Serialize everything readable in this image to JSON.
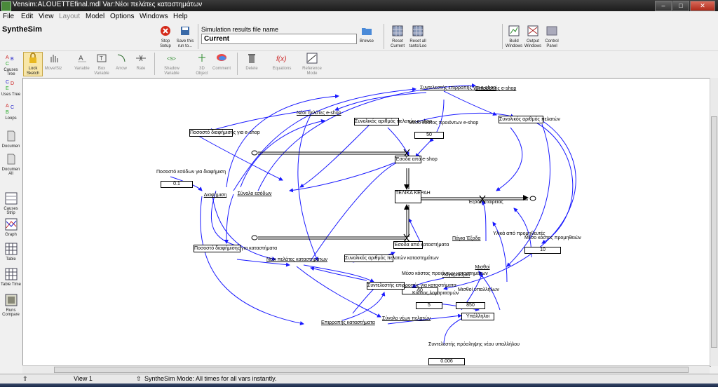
{
  "window": {
    "title": "Vensim:ALOUETTEfinal.mdl Var:Νέοι πελάτες καταστημάτων"
  },
  "menu": {
    "file": "File",
    "edit": "Edit",
    "view": "View",
    "layout": "Layout",
    "model": "Model",
    "options": "Options",
    "windows": "Windows",
    "help": "Help"
  },
  "toolbar": {
    "synthesim": "SyntheSim",
    "stop_setup": "Stop Setup",
    "save_run": "Save this run to...",
    "sim_file_label": "Simulation results file name",
    "sim_file_value": "Current",
    "browse": "Browse",
    "reset_current": "Reset Current",
    "reset_all": "Reset all tants/Loo",
    "build_windows": "Build Windows",
    "output_windows": "Output Windows",
    "control_panel": "Control Panel"
  },
  "sketch_tools": {
    "lock": "Lock Sketch",
    "move": "Move/Siz",
    "variable": "Variable",
    "box": "Box Variable",
    "arrow": "Arrow",
    "rate": "Rate",
    "shadow": "Shadow Variable",
    "obj3d": "3D Object",
    "comment": "Comment",
    "delete": "Delete",
    "equations": "Equations",
    "reference": "Reference Mode"
  },
  "left_tools": {
    "causes_tree": "Causes Tree",
    "uses_tree": "Uses Tree",
    "loops": "Loops",
    "document": "Documen",
    "document_all": "Documen All",
    "causes_strip": "Causes Strip",
    "graph": "Graph",
    "table": "Table",
    "table_time": "Table Time",
    "runs_compare": "Runs Compare"
  },
  "model": {
    "syntelestis_eshop": "Συντελεστής επιρροπής για e-shop",
    "epiroi_eshop": "Επιρροπής e-shop",
    "neoi_pelates_eshop": "Νέοι πελάτες e-shop",
    "synolikos_eshop": "Συνολικός αριθμός πελατών e-shop",
    "meso_kostos_eshop": "Μέσο κόστος προιόντων e-shop",
    "meso_kostos_eshop_val": "50",
    "synolikos_pelaton": "Συνολικός αριθμός πελατών",
    "pososto_eshop": "Ποσοστό διαφήμισης για e-shop",
    "esoda_eshop": "Έσοδα από e-shop",
    "pososto_esodon": "Ποσοστό εσόδων για διαφήμιση",
    "pososto_esodon_val": "0.1",
    "diafimisi": "Διαφήμιση",
    "synolo_esodon": "Σύνολο εσόδων",
    "telika_kerdi": "ΤΕΛΙΚΑ ΚΕΡΔΗ",
    "esoda_exoda": "Έξοδα εταιρείας",
    "pagia_exoda": "Πάγια Έξοδα",
    "ylika": "Υλικά από προμηθευτές",
    "meso_kostos_promitheion": "Μέσο κόστος προμηθειών",
    "meso_kostos_promitheion_val": "10",
    "pososto_katastimata": "Ποσοστό διαφήμισης για καταστήματα",
    "esoda_katastimata": "Έσοδα από καταστήματα",
    "neoi_pelates_katastimata": "Νέοι πελάτες καταστημάτων",
    "synolikos_katastimata": "Συνολικός αριθμός πελατών καταστημάτων",
    "meso_kostos_katastimata": "Μέσο κόστος προιόντων καταστημάτων",
    "meso_kostos_katastimata_val": "60",
    "logariasmoi": "Λογαριασμοί",
    "misthoi": "Μισθοί",
    "syntelestis_katastimata": "Συντελεστής επιρροπής για καταστήματα",
    "kostos_logariasmon": "Κόστος λογαριασμών",
    "kostos_logariasmon_val": "5",
    "misthoi_ypallilon": "Μισθοί υπαλλήλων",
    "misthoi_ypallilon_val": "850",
    "epiroi_katastimata": "Επιρροπής καταστήματα",
    "synolo_neon_pelaton": "Σύνολο νέων πελατών",
    "ypalliloi": "Υπάλληλοι",
    "syntelestis_proslipsis": "Συντελεστής πρόσληψης νέου υπαλλήλου",
    "syntelestis_proslipsis_val": "0.006"
  },
  "status": {
    "view": "View 1",
    "mode_text": "SyntheSim Mode: All times for all vars instantly."
  },
  "colors": {
    "link": "#1a1aff",
    "stock": "#000000"
  }
}
